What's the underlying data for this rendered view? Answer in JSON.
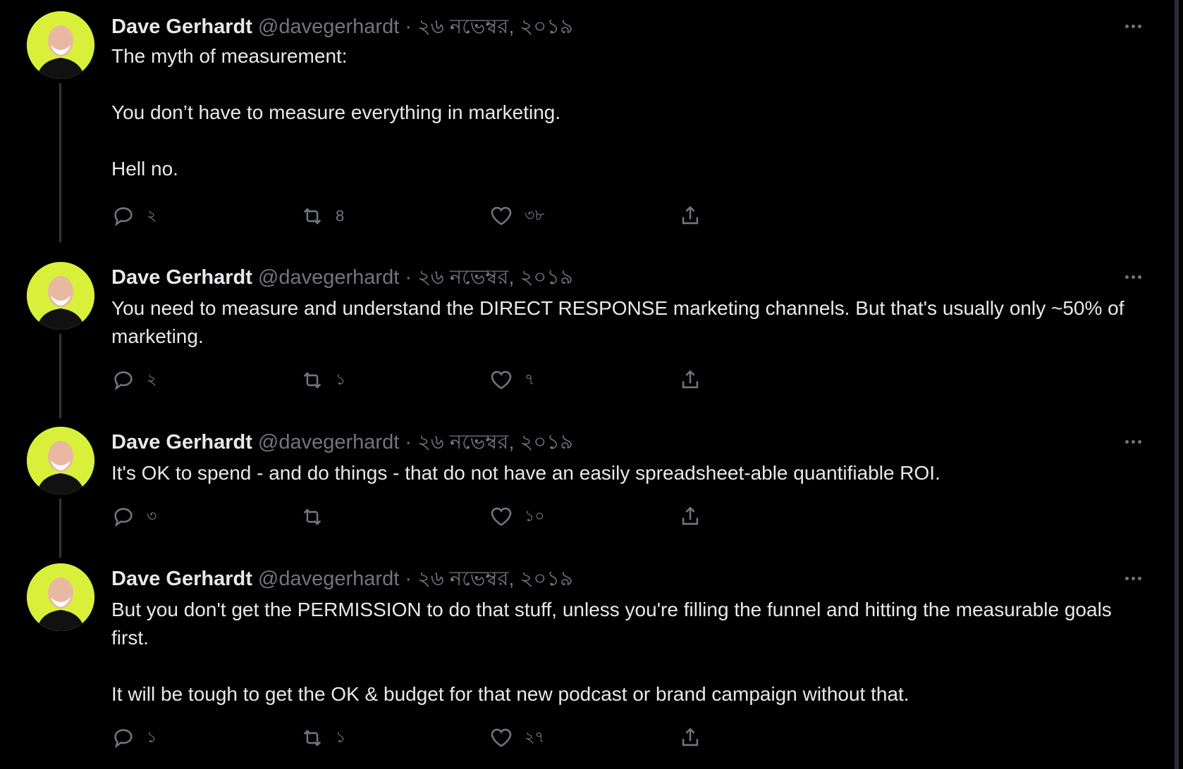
{
  "tweets": [
    {
      "name": "Dave Gerhardt",
      "handle": "@davegerhardt",
      "separator": "·",
      "date": "২৬ নভেম্বর, ২০১৯",
      "paragraphs": [
        "The myth of measurement:",
        "You don’t have to measure everything in marketing.",
        "Hell no."
      ],
      "replies": "২",
      "retweets": "8",
      "likes": "৩৮"
    },
    {
      "name": "Dave Gerhardt",
      "handle": "@davegerhardt",
      "separator": "·",
      "date": "২৬ নভেম্বর, ২০১৯",
      "paragraphs": [
        "You need to measure and understand the DIRECT RESPONSE marketing channels. But that's usually only ~50% of marketing."
      ],
      "replies": "২",
      "retweets": "১",
      "likes": "৭"
    },
    {
      "name": "Dave Gerhardt",
      "handle": "@davegerhardt",
      "separator": "·",
      "date": "২৬ নভেম্বর, ২০১৯",
      "paragraphs": [
        "It's OK to spend - and do things - that do not have an easily spreadsheet-able quantifiable ROI."
      ],
      "replies": "৩",
      "retweets": "",
      "likes": "১০"
    },
    {
      "name": "Dave Gerhardt",
      "handle": "@davegerhardt",
      "separator": "·",
      "date": "২৬ নভেম্বর, ২০১৯",
      "paragraphs": [
        "But you don't get the PERMISSION to do that stuff, unless you're filling the funnel and hitting the measurable goals first.",
        "It will be tough to get the OK & budget for that new podcast or brand campaign without that."
      ],
      "replies": "১",
      "retweets": "১",
      "likes": "২৭"
    }
  ],
  "icons": {
    "reply": "reply-icon",
    "retweet": "retweet-icon",
    "like": "heart-icon",
    "share": "share-icon",
    "more": "more-icon"
  },
  "colors": {
    "background": "#000000",
    "text": "#e7e9ea",
    "muted": "#71767b",
    "avatar_bg": "#d8f03a"
  }
}
